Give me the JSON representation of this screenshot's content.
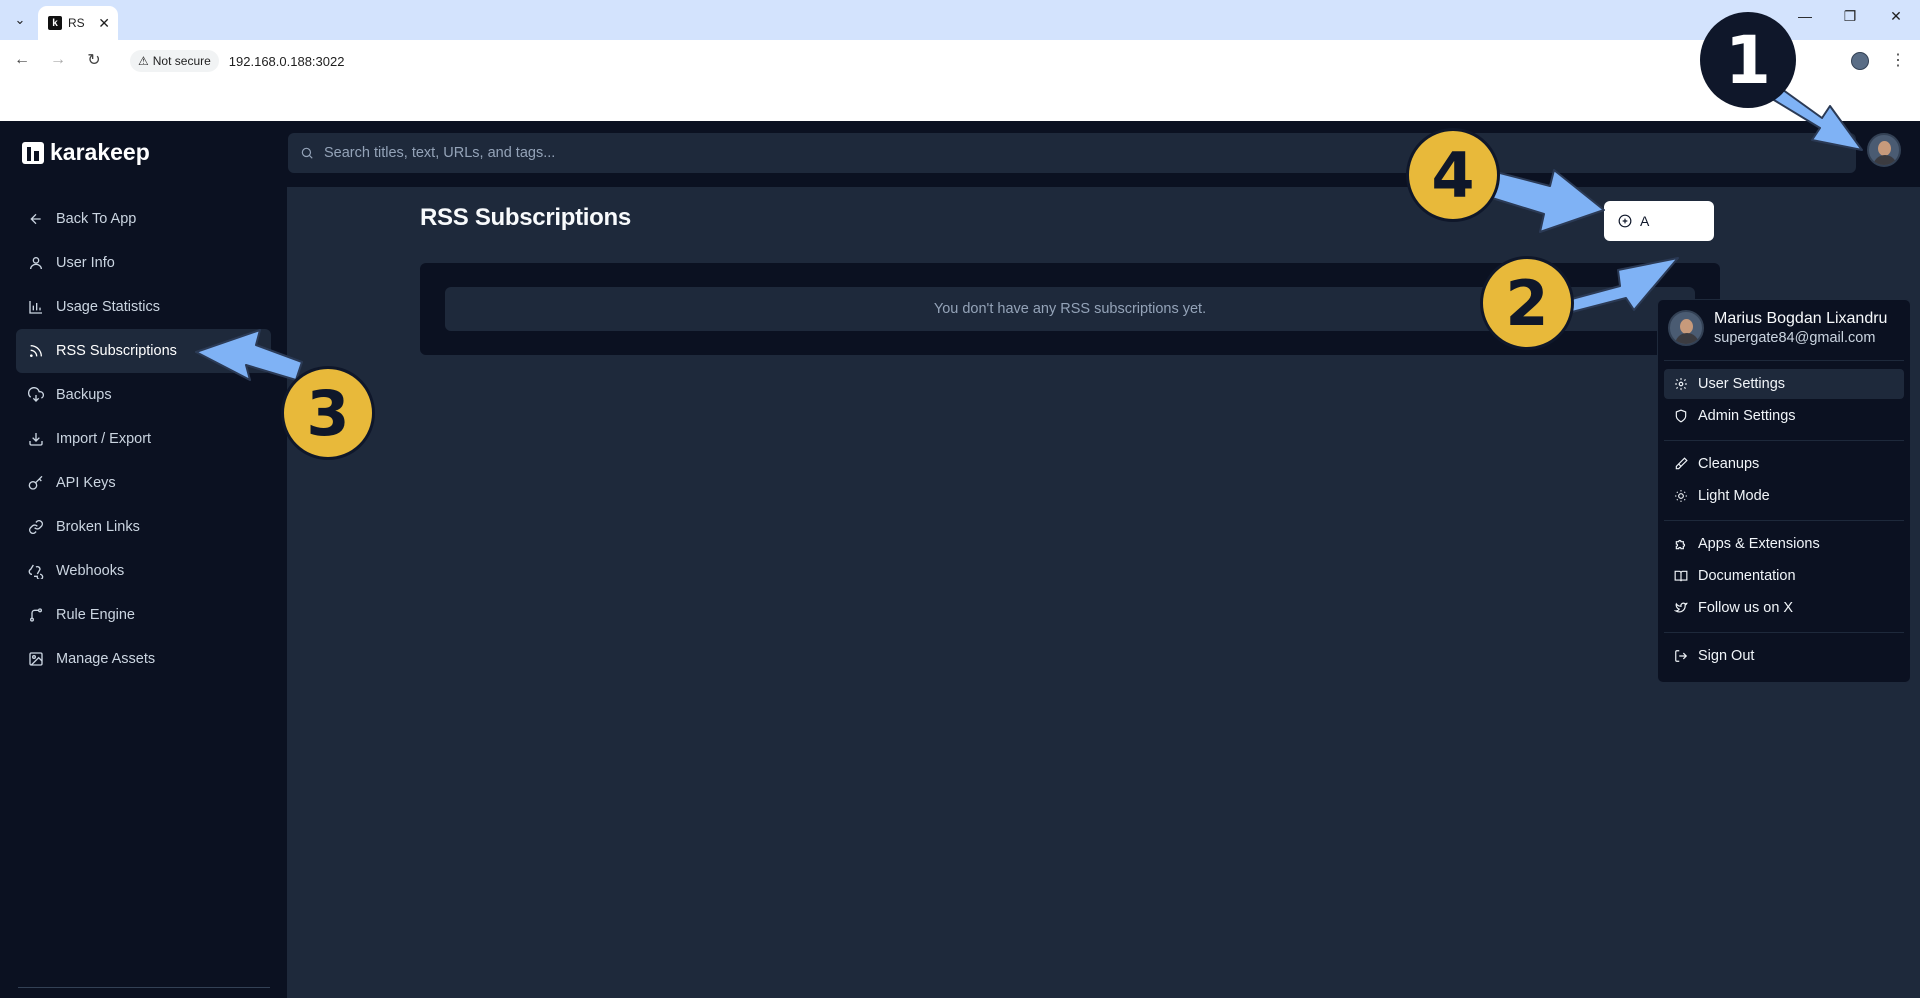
{
  "browser": {
    "tab_title": "RS",
    "security_label": "Not secure",
    "url": "192.168.0.188:3022"
  },
  "app": {
    "logo_text": "karakeep",
    "search_placeholder": "Search titles, text, URLs, and tags...",
    "page_title": "RSS Subscriptions",
    "add_button_label": "A",
    "empty_message": "You don't have any RSS subscriptions yet."
  },
  "sidebar": {
    "items": [
      {
        "label": "Back To App",
        "icon": "arrow-left-icon"
      },
      {
        "label": "User Info",
        "icon": "user-icon"
      },
      {
        "label": "Usage Statistics",
        "icon": "bar-chart-icon"
      },
      {
        "label": "RSS Subscriptions",
        "icon": "rss-icon",
        "active": true
      },
      {
        "label": "Backups",
        "icon": "cloud-download-icon"
      },
      {
        "label": "Import / Export",
        "icon": "download-icon"
      },
      {
        "label": "API Keys",
        "icon": "key-icon"
      },
      {
        "label": "Broken Links",
        "icon": "link-icon"
      },
      {
        "label": "Webhooks",
        "icon": "webhook-icon"
      },
      {
        "label": "Rule Engine",
        "icon": "git-branch-icon"
      },
      {
        "label": "Manage Assets",
        "icon": "image-icon"
      }
    ]
  },
  "user_menu": {
    "name": "Marius Bogdan Lixandru",
    "email": "supergate84@gmail.com",
    "items": [
      {
        "label": "User Settings",
        "icon": "gear-icon"
      },
      {
        "label": "Admin Settings",
        "icon": "shield-icon"
      },
      {
        "label": "Cleanups",
        "icon": "paintbrush-icon"
      },
      {
        "label": "Light Mode",
        "icon": "sun-icon"
      },
      {
        "label": "Apps & Extensions",
        "icon": "puzzle-icon"
      },
      {
        "label": "Documentation",
        "icon": "book-icon"
      },
      {
        "label": "Follow us on X",
        "icon": "twitter-icon"
      },
      {
        "label": "Sign Out",
        "icon": "log-out-icon"
      }
    ]
  },
  "annotations": {
    "step_1": "1",
    "step_2": "2",
    "step_3": "3",
    "step_4": "4",
    "colors": {
      "badge_dark": "#0f172a",
      "badge_gold": "#e8b93a",
      "arrow": "#7fb2f5"
    }
  }
}
